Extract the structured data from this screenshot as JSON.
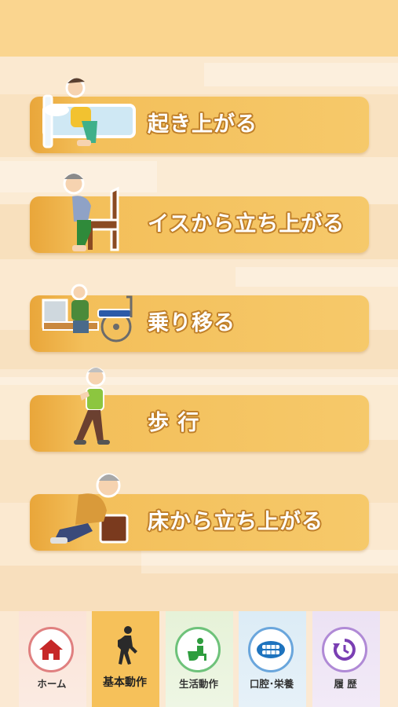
{
  "menu": {
    "items": [
      {
        "label": "起き上がる",
        "icon": "person-getting-up-from-bed-icon"
      },
      {
        "label": "イスから立ち上がる",
        "icon": "person-standing-from-chair-icon"
      },
      {
        "label": "乗り移る",
        "icon": "person-transferring-to-wheelchair-icon"
      },
      {
        "label": "歩 行",
        "icon": "person-walking-icon"
      },
      {
        "label": "床から立ち上がる",
        "icon": "person-rising-from-floor-icon"
      }
    ]
  },
  "bottom_nav": {
    "items": [
      {
        "label": "ホーム",
        "icon": "home-icon",
        "color": "#c62828"
      },
      {
        "label": "基本動作",
        "icon": "walking-person-icon",
        "active": true
      },
      {
        "label": "生活動作",
        "icon": "toilet-person-icon",
        "color": "#2e9d3e"
      },
      {
        "label": "口腔･栄養",
        "icon": "mouth-teeth-icon",
        "color": "#1e73be"
      },
      {
        "label": "履 歴",
        "icon": "history-icon",
        "color": "#7a3fb3"
      }
    ]
  },
  "colors": {
    "button": "#f3bf5a",
    "header": "#fad58f",
    "active_tab": "#f6c15a"
  }
}
